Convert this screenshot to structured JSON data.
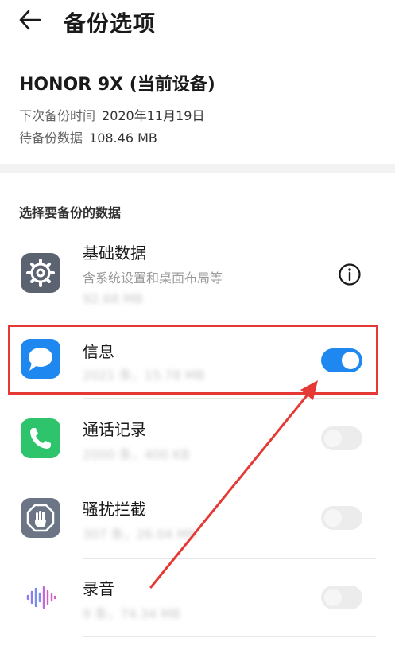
{
  "header": {
    "title": "备份选项"
  },
  "device": {
    "name": "HONOR 9X (当前设备)",
    "next_backup_label": "下次备份时间",
    "next_backup_value": "2020年11月19日",
    "pending_label": "待备份数据",
    "pending_value": "108.46 MB"
  },
  "section": {
    "label": "选择要备份的数据"
  },
  "items": [
    {
      "title": "基础数据",
      "subtitle": "含系统设置和桌面布局等",
      "size": "92.68 MB",
      "icon": "settings-gear-icon",
      "control": "info"
    },
    {
      "title": "信息",
      "size": "2021 条，15.78 MB",
      "icon": "message-bubble-icon",
      "toggle": "on"
    },
    {
      "title": "通话记录",
      "size": "2000 条，400 KB",
      "icon": "phone-icon",
      "toggle": "off"
    },
    {
      "title": "骚扰拦截",
      "size": "307 条，26.04 MB",
      "icon": "hand-block-icon",
      "toggle": "off"
    },
    {
      "title": "录音",
      "size": "9 条，74.34 MB",
      "icon": "waveform-icon",
      "toggle": "off"
    }
  ],
  "colors": {
    "toggle_on": "#1e88f0",
    "highlight": "#e53935",
    "message_icon": "#1e88f0",
    "phone_icon": "#2ec46b"
  }
}
